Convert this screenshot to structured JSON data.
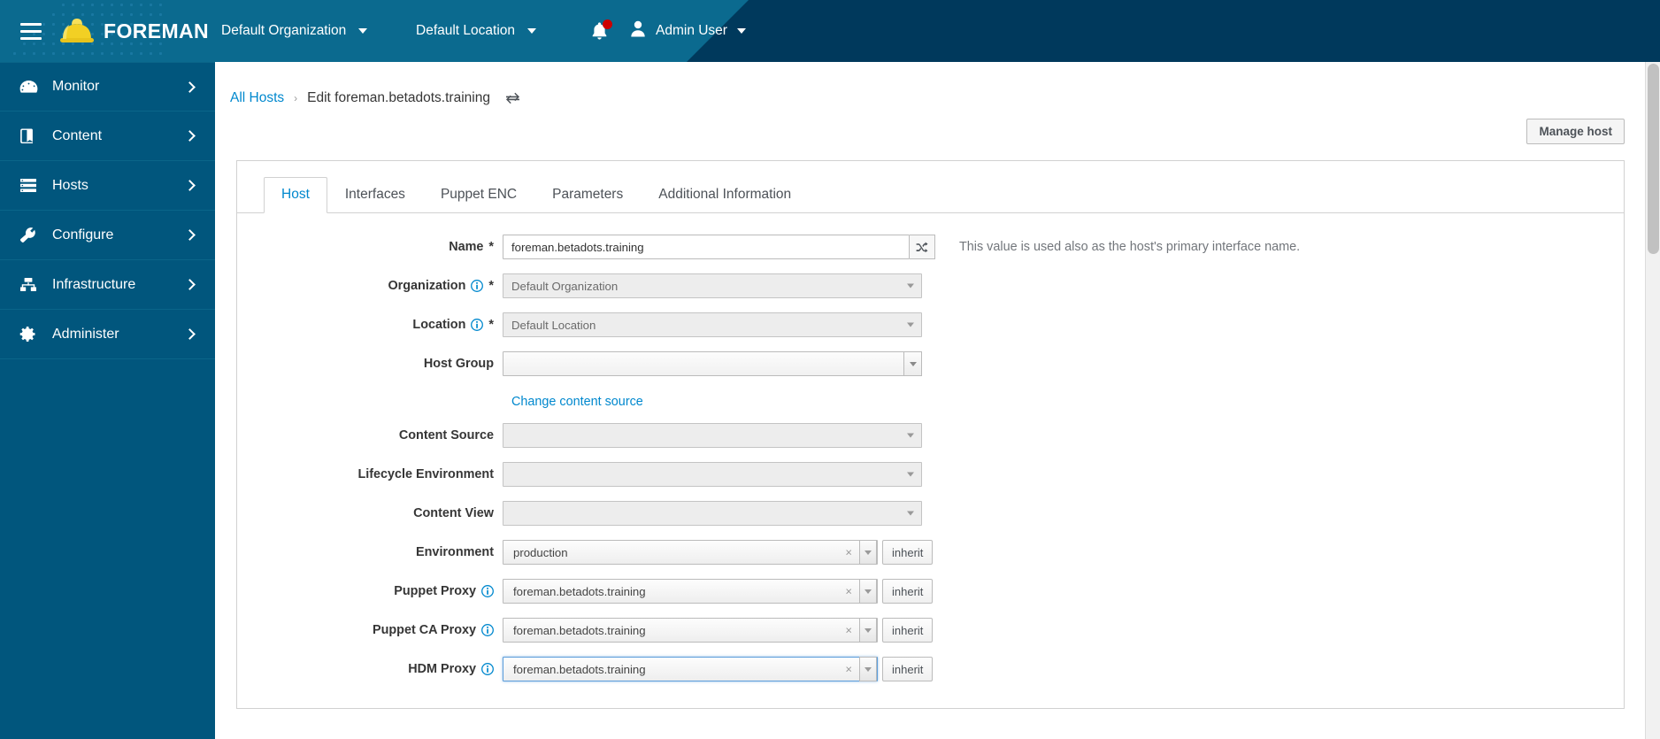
{
  "masthead": {
    "menu_icon": "hamburger-icon",
    "brand_name": "FOREMAN",
    "brand_logo_icon": "hardhat-logo-icon",
    "organization_label": "Default Organization",
    "location_label": "Default Location",
    "notifications_icon": "bell-icon",
    "notification_badge": "",
    "user_icon": "user-avatar-icon",
    "user_label": "Admin User",
    "colors": {
      "teal": "#0b6a8f",
      "navy": "#00395c",
      "badge_red": "#cc0000"
    }
  },
  "sidebar": {
    "background": "#01567d",
    "items": [
      {
        "label": "Monitor",
        "icon": "dashboard-icon"
      },
      {
        "label": "Content",
        "icon": "book-icon"
      },
      {
        "label": "Hosts",
        "icon": "server-rack-icon"
      },
      {
        "label": "Configure",
        "icon": "wrench-icon"
      },
      {
        "label": "Infrastructure",
        "icon": "sitemap-icon"
      },
      {
        "label": "Administer",
        "icon": "gear-icon"
      }
    ]
  },
  "breadcrumb": {
    "root_label": "All Hosts",
    "separator": "›",
    "current_label": "Edit foreman.betadots.training",
    "switcher_icon": "exchange-arrows-icon"
  },
  "toolbar": {
    "manage_host_label": "Manage host"
  },
  "tabs": [
    {
      "label": "Host",
      "active": true
    },
    {
      "label": "Interfaces",
      "active": false
    },
    {
      "label": "Puppet ENC",
      "active": false
    },
    {
      "label": "Parameters",
      "active": false
    },
    {
      "label": "Additional Information",
      "active": false
    }
  ],
  "form": {
    "name": {
      "label": "Name",
      "required_marker": "*",
      "value": "foreman.betadots.training",
      "addon_icon": "shuffle-icon",
      "help_text": "This value is used also as the host's primary interface name."
    },
    "organization": {
      "label": "Organization",
      "required_marker": "*",
      "info_icon": "info-circle-icon",
      "value": "Default Organization"
    },
    "location": {
      "label": "Location",
      "required_marker": "*",
      "info_icon": "info-circle-icon",
      "value": "Default Location"
    },
    "host_group": {
      "label": "Host Group",
      "value": ""
    },
    "change_content_source": {
      "link_label": "Change content source"
    },
    "content_source": {
      "label": "Content Source",
      "value": ""
    },
    "lifecycle_environment": {
      "label": "Lifecycle Environment",
      "value": ""
    },
    "content_view": {
      "label": "Content View",
      "value": ""
    },
    "environment": {
      "label": "Environment",
      "value": "production",
      "clear_icon": "×",
      "inherit_label": "inherit"
    },
    "puppet_proxy": {
      "label": "Puppet Proxy",
      "info_icon": "info-circle-icon",
      "value": "foreman.betadots.training",
      "clear_icon": "×",
      "inherit_label": "inherit"
    },
    "puppet_ca_proxy": {
      "label": "Puppet CA Proxy",
      "info_icon": "info-circle-icon",
      "value": "foreman.betadots.training",
      "clear_icon": "×",
      "inherit_label": "inherit"
    },
    "hdm_proxy": {
      "label": "HDM Proxy",
      "info_icon": "info-circle-icon",
      "value": "foreman.betadots.training",
      "clear_icon": "×",
      "inherit_label": "inherit",
      "focused": true
    }
  }
}
